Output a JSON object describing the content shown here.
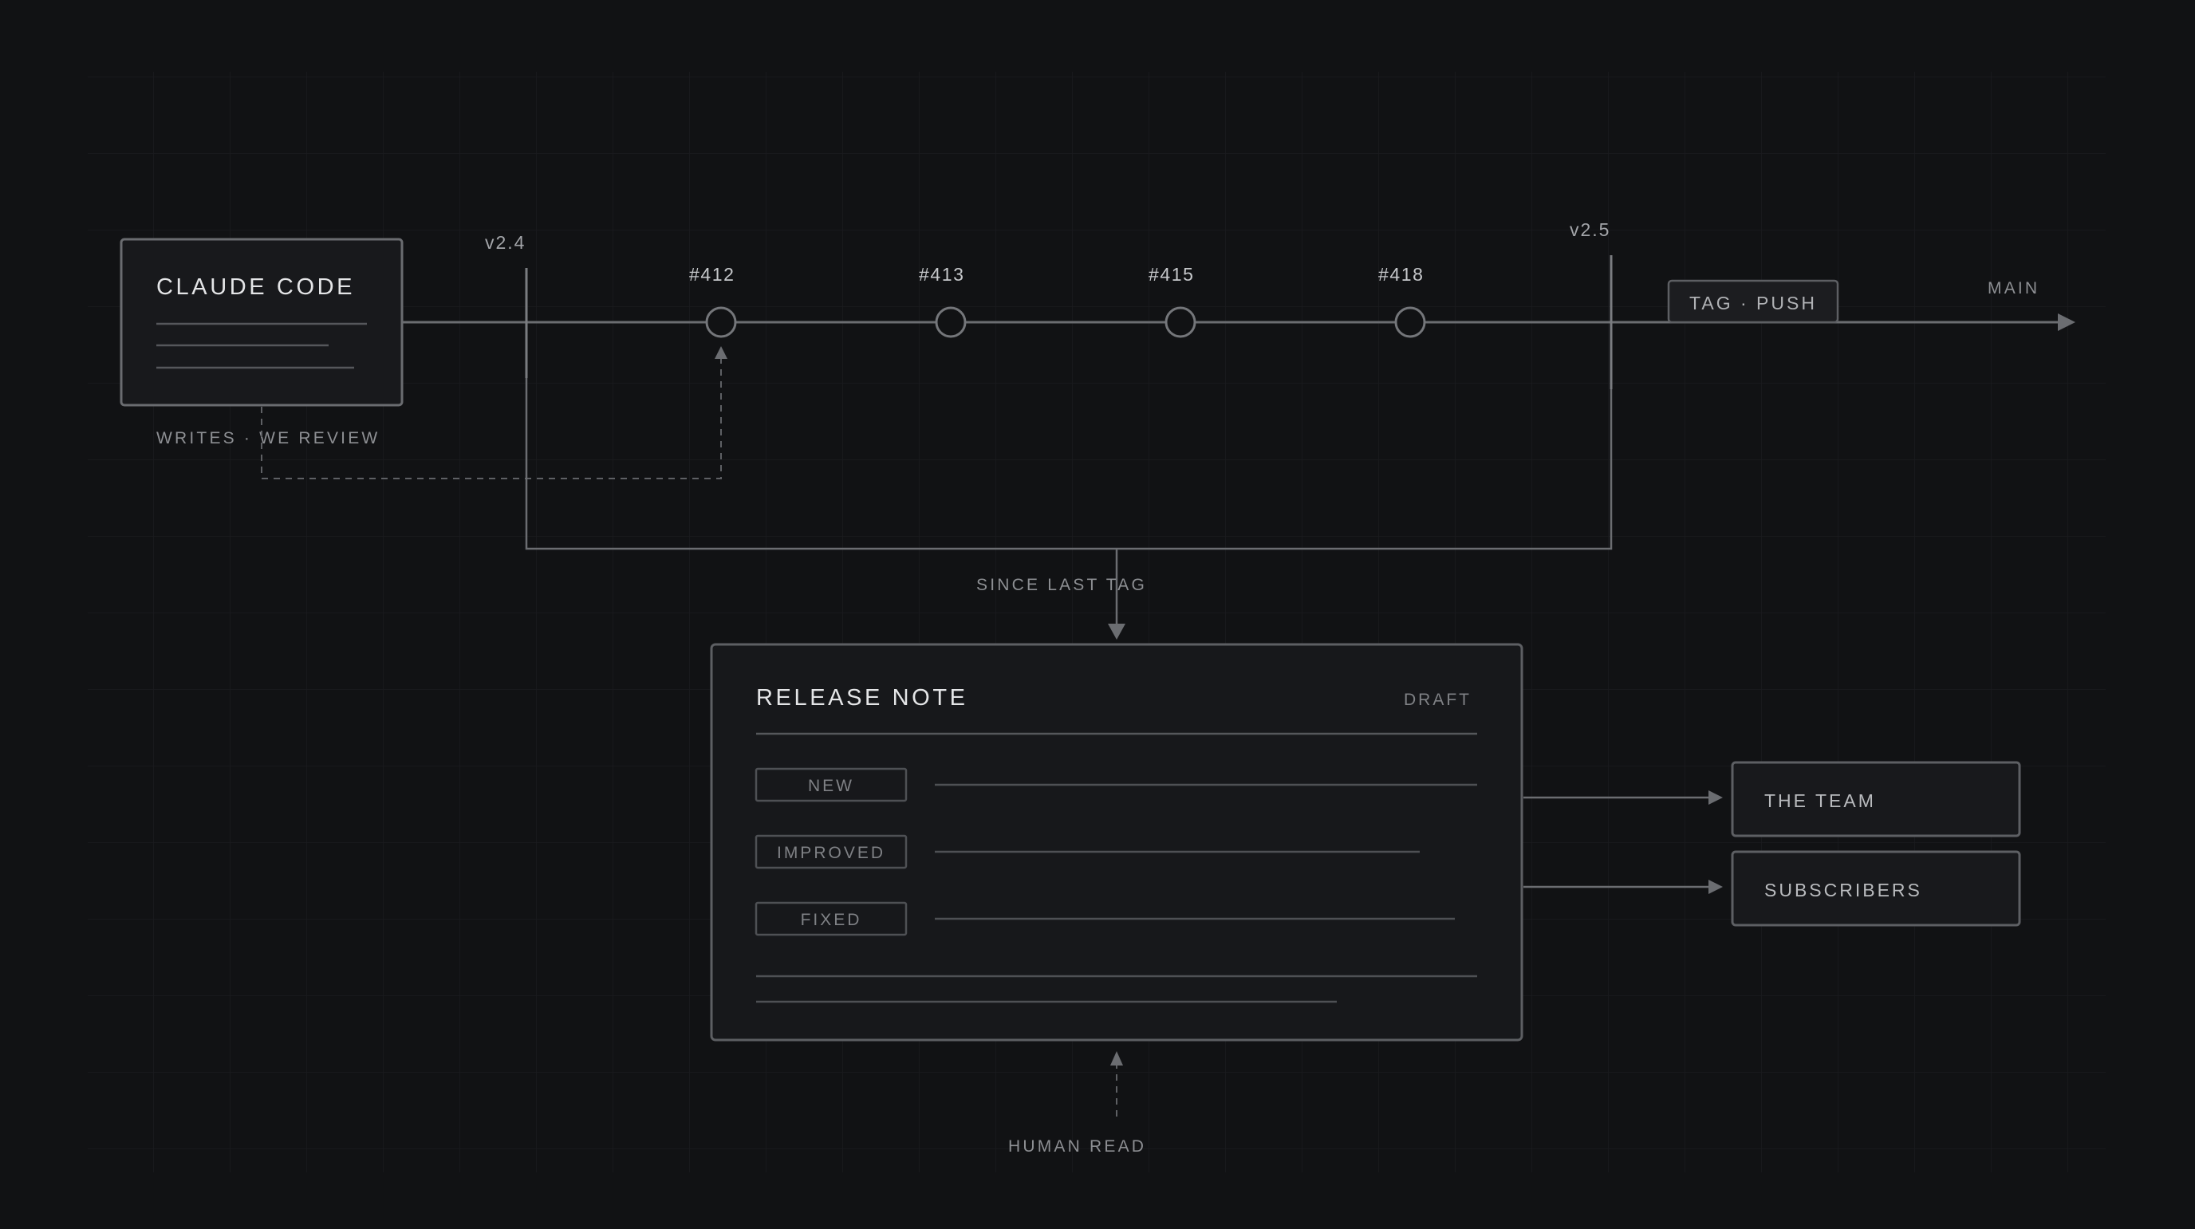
{
  "agent": {
    "title": "CLAUDE CODE",
    "caption": "WRITES · WE REVIEW"
  },
  "timeline": {
    "start_tag": "v2.4",
    "end_tag": "v2.5",
    "branch_label": "MAIN",
    "action_button": "TAG · PUSH",
    "commits": [
      "#412",
      "#413",
      "#415",
      "#418"
    ]
  },
  "range_label": "SINCE LAST TAG",
  "release_note": {
    "title": "RELEASE NOTE",
    "status": "DRAFT",
    "sections": [
      "NEW",
      "IMPROVED",
      "FIXED"
    ]
  },
  "audiences": [
    "THE TEAM",
    "SUBSCRIBERS"
  ],
  "reader_label": "HUMAN READ",
  "colors": {
    "background": "#111214",
    "grid": "#1a1b1e",
    "line": "#6b6d71",
    "panel": "#17181b",
    "panel_border": "#5d5f63"
  }
}
